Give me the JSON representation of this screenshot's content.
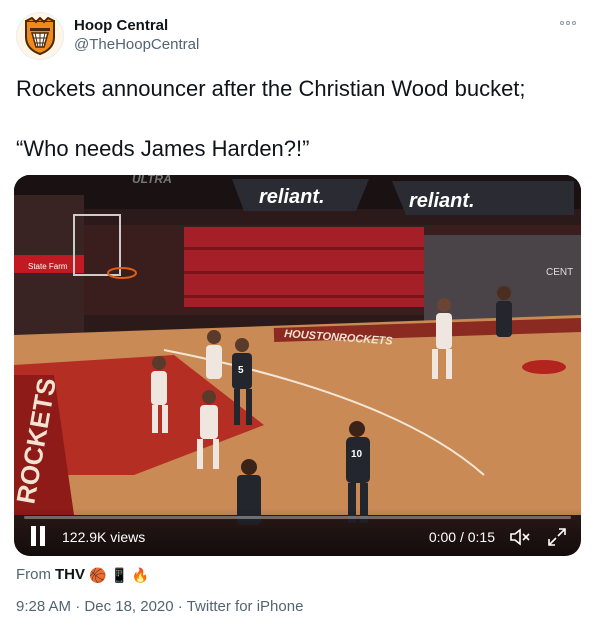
{
  "author": {
    "display_name": "Hoop Central",
    "handle": "@TheHoopCentral",
    "avatar_icon": "basketball-shield-logo-icon"
  },
  "tweet": {
    "line1": "Rockets announcer after the Christian Wood bucket;",
    "line2": "“Who needs James Harden?!”"
  },
  "video": {
    "views": "122.9K views",
    "time": "0:00 / 0:15",
    "scene_text": {
      "sponsor_left": "reliant.",
      "sponsor_right": "reliant.",
      "court_banner": "HOUSTONROCKETS",
      "baseline": "ROCKETS",
      "player_a_number": "5",
      "player_b_number": "10",
      "arena_sign": "CENT",
      "top_sign": "ULTRA",
      "small_sign": "State Farm"
    }
  },
  "source": {
    "prefix": "From",
    "name": "THV",
    "emoji": [
      "🏀",
      "📱",
      "🔥"
    ]
  },
  "meta": {
    "time": "9:28 AM",
    "sep1": "·",
    "date": "Dec 18, 2020",
    "sep2": "·",
    "client": "Twitter for iPhone"
  },
  "colors": {
    "court": "#c98a55",
    "paint": "#b3241f",
    "seats": "#b8202a",
    "brand": "#e0700c"
  }
}
